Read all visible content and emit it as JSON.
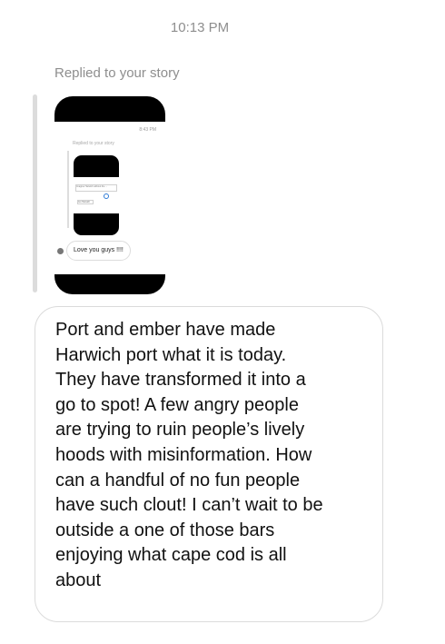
{
  "timestamp": "10:13 PM",
  "reply": {
    "label": "Replied to your story"
  },
  "story_preview": {
    "time": "8:43 PM",
    "replied_label": "Replied to your story",
    "field_text": "Imagine Harwich without the ...",
    "chip_text": "Go Harwich",
    "bubble_text": "Love you guys !!!!"
  },
  "message": {
    "lines": [
      "Port and ember have made",
      "Harwich port what it is today.",
      "They have transformed it into a",
      "go to spot! A few angry people",
      "are trying to ruin people’s lively",
      "hoods with misinformation. How",
      "can a handful of no fun people",
      "have such clout! I can’t wait to be",
      "outside a one of those bars",
      "enjoying what cape cod is all",
      "about"
    ]
  }
}
